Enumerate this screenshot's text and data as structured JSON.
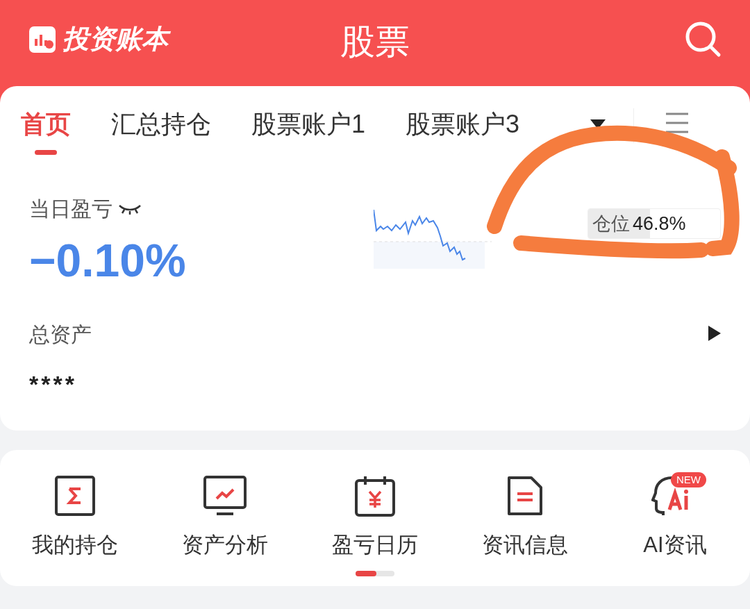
{
  "header": {
    "logo": "投资账本",
    "title": "股票"
  },
  "tabs": [
    {
      "label": "首页",
      "selected": true
    },
    {
      "label": "汇总持仓",
      "selected": false
    },
    {
      "label": "股票账户1",
      "selected": false
    },
    {
      "label": "股票账户3",
      "selected": false
    }
  ],
  "summary": {
    "daily_pnl_label": "当日盈亏",
    "daily_pnl_value": "−0.10%",
    "position": {
      "label": "仓位",
      "value": "46.8%",
      "level": 0.468
    },
    "total_assets_label": "总资产",
    "total_assets_value": "****"
  },
  "shortcuts": [
    {
      "label": "我的持仓"
    },
    {
      "label": "资产分析"
    },
    {
      "label": "盈亏日历"
    },
    {
      "label": "资讯信息"
    },
    {
      "label": "AI资讯",
      "badge": "NEW"
    }
  ]
}
